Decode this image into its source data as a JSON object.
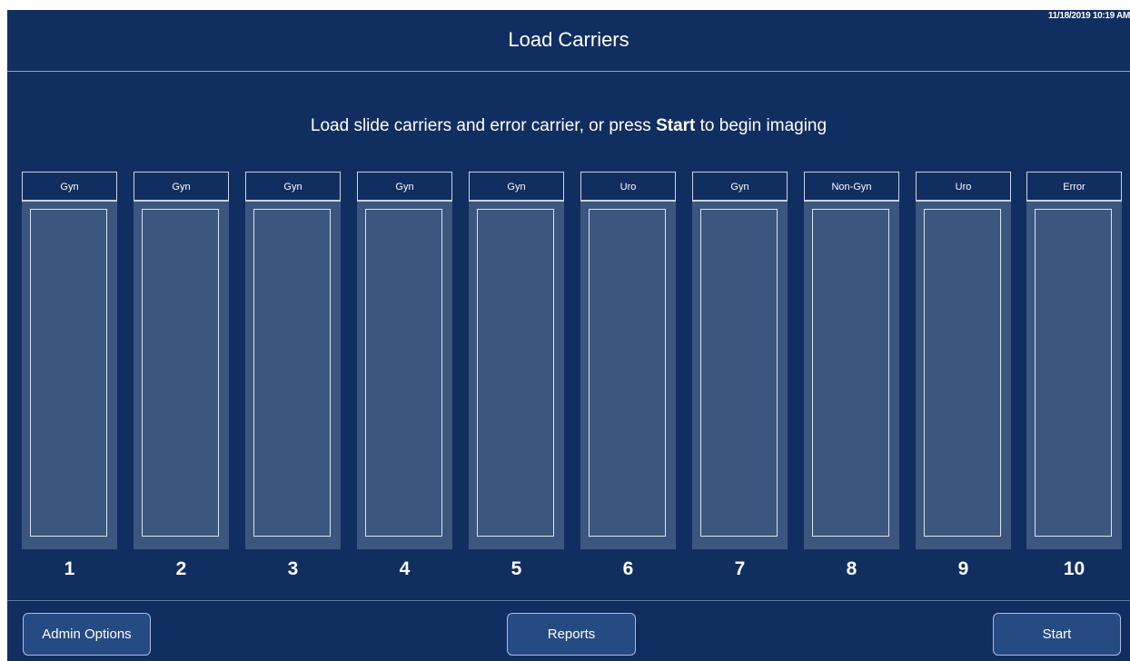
{
  "header": {
    "title": "Load Carriers",
    "datetime": "11/18/2019 10:19 AM"
  },
  "instruction": {
    "prefix": "Load slide carriers and error carrier, or press ",
    "emphasis": "Start",
    "suffix": " to begin imaging"
  },
  "carriers": [
    {
      "label": "Gyn",
      "number": "1"
    },
    {
      "label": "Gyn",
      "number": "2"
    },
    {
      "label": "Gyn",
      "number": "3"
    },
    {
      "label": "Gyn",
      "number": "4"
    },
    {
      "label": "Gyn",
      "number": "5"
    },
    {
      "label": "Uro",
      "number": "6"
    },
    {
      "label": "Gyn",
      "number": "7"
    },
    {
      "label": "Non-Gyn",
      "number": "8"
    },
    {
      "label": "Uro",
      "number": "9"
    },
    {
      "label": "Error",
      "number": "10"
    }
  ],
  "footer": {
    "admin_label": "Admin Options",
    "reports_label": "Reports",
    "start_label": "Start"
  },
  "colors": {
    "background": "#112e61",
    "carrier_fill": "#3c577f",
    "button_fill": "#264a82"
  }
}
